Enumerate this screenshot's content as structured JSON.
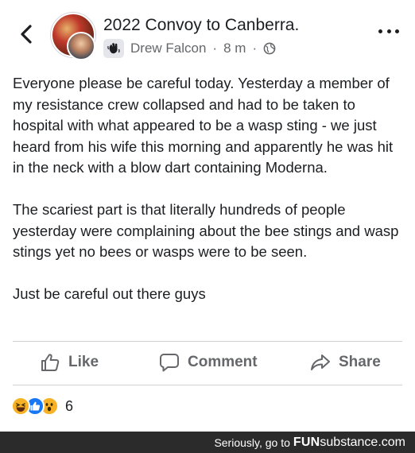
{
  "header": {
    "group_name": "2022 Convoy to Canberra.",
    "author": "Drew Falcon",
    "separator": "·",
    "time_ago": "8 m",
    "separator_2": "·"
  },
  "post": {
    "paragraphs": [
      "Everyone please be careful today. Yesterday a member of my resistance crew collapsed and had to be taken to hospital with what appeared to be a wasp sting - we just heard from his wife this morning and apparently he was hit in the neck with a blow dart containing Moderna.",
      "The scariest part is that literally hundreds of people yesterday were complaining about the bee stings and wasp stings yet no bees or wasps were to be seen.",
      "Just be careful out there guys"
    ]
  },
  "actions": {
    "like_label": "Like",
    "comment_label": "Comment",
    "share_label": "Share"
  },
  "reactions": {
    "icons": [
      "haha-reaction-icon",
      "like-reaction-icon",
      "wow-reaction-icon"
    ],
    "count": "6"
  },
  "footer": {
    "prefix": "Seriously, go to",
    "brand_fun": "FUN",
    "brand_rest": "substance.com"
  },
  "colors": {
    "text": "#1c1e21",
    "secondary": "#65676b",
    "like_blue": "#1877f2",
    "reaction_yellow": "#f7b125",
    "footer_bg": "#2b2b2b"
  }
}
